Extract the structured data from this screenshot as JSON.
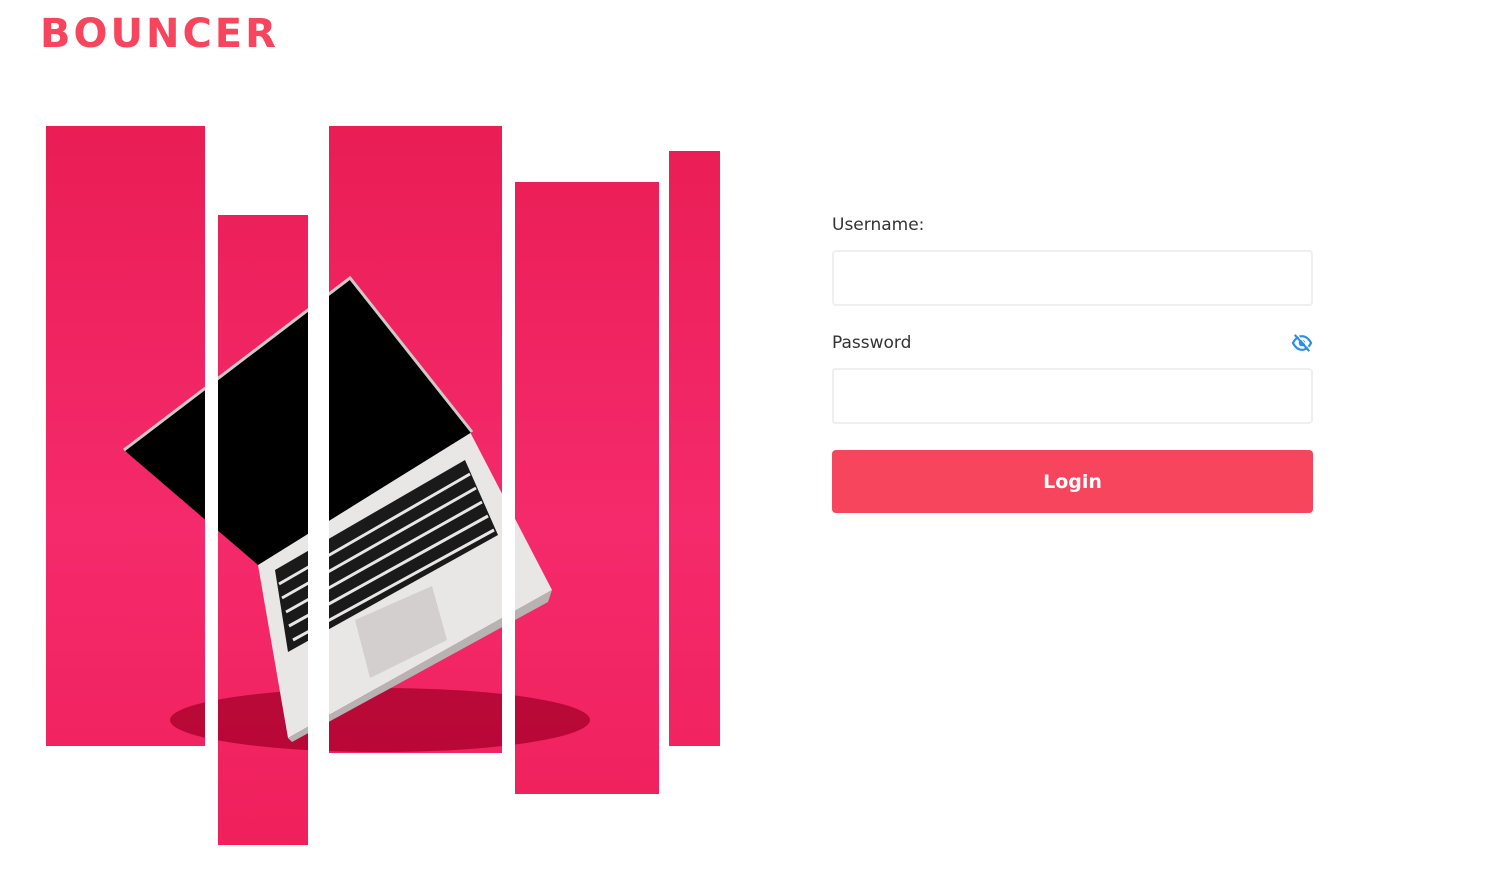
{
  "brand": {
    "logo_text": "BOUNCER",
    "color": "#f6455c"
  },
  "hero": {
    "image": "laptop-on-pink-striped-illustration",
    "background_color": "#f12a64",
    "screen_color": "#000000",
    "body_color": "#eeeeee"
  },
  "login_form": {
    "username_label": "Username:",
    "username_value": "",
    "password_label": "Password",
    "password_value": "",
    "password_toggle_icon": "eye-slash-icon",
    "toggle_color": "#2d8ee8",
    "submit_label": "Login"
  }
}
